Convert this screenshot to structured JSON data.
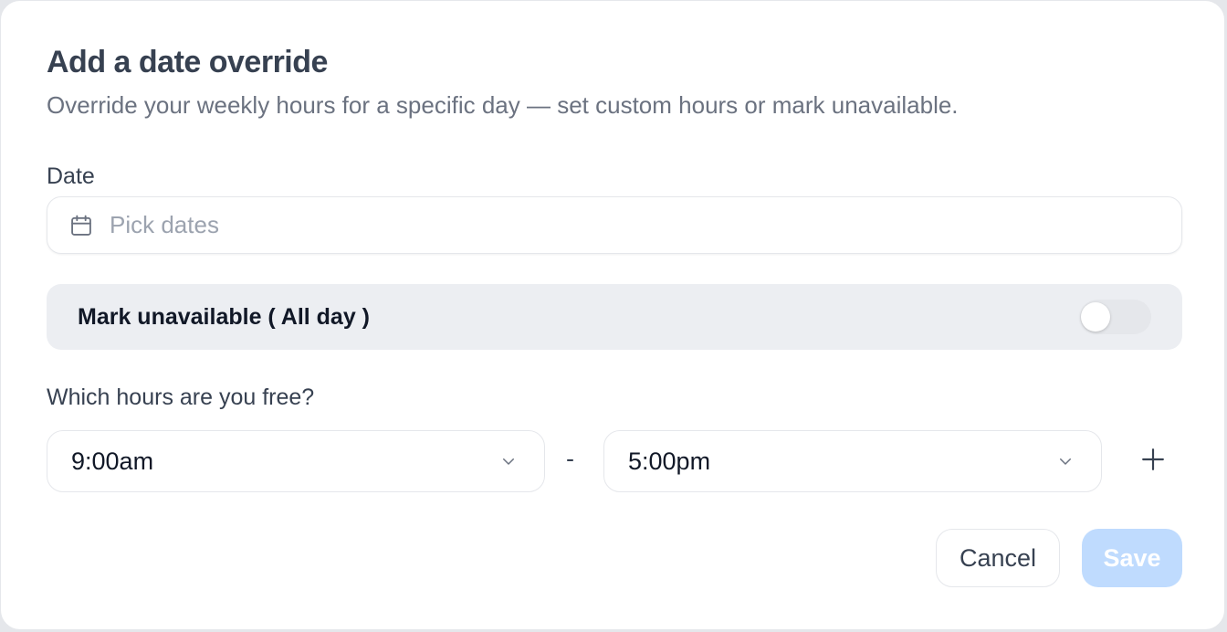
{
  "dialog": {
    "title": "Add a date override",
    "subtitle": "Override your weekly hours for a specific day — set custom hours or mark unavailable."
  },
  "date": {
    "label": "Date",
    "placeholder": "Pick dates",
    "icon": "calendar-icon"
  },
  "unavailable": {
    "label": "Mark unavailable ( All day )",
    "toggle_on": false
  },
  "hours": {
    "label": "Which hours are you free?",
    "start": "9:00am",
    "separator": "-",
    "end": "5:00pm",
    "add_icon": "plus-icon"
  },
  "actions": {
    "cancel_label": "Cancel",
    "save_label": "Save"
  },
  "colors": {
    "save_disabled_bg": "#bfdbfe",
    "toggle_off_bg": "#e5e7eb",
    "row_bg": "#eceef2"
  }
}
